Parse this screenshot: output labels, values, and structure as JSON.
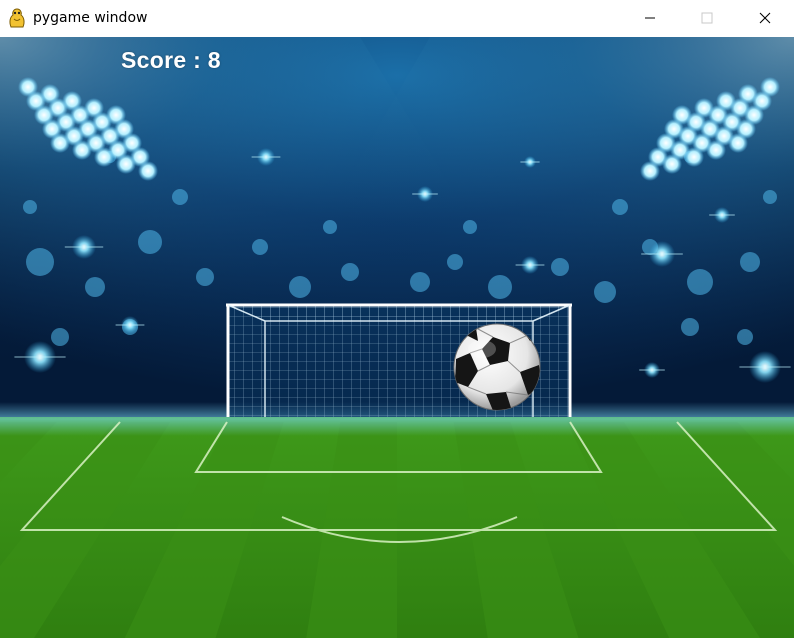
{
  "window": {
    "title": "pygame window",
    "app_icon": "pygame-snake-icon",
    "controls": [
      "minimize-icon",
      "maximize-icon",
      "close-icon"
    ]
  },
  "hud": {
    "score_label": "Score",
    "score_value": "8"
  },
  "scene": {
    "background": "night stadium with floodlights",
    "goal": "soccer goal with net",
    "ball": "soccer ball",
    "field": "green striped pitch",
    "colors": {
      "sky_dark": "#041a38",
      "sky_light": "#1b6fa8",
      "grass_light": "#46a31c",
      "grass_dark": "#2e7a12",
      "glow": "#7fdfff"
    }
  }
}
